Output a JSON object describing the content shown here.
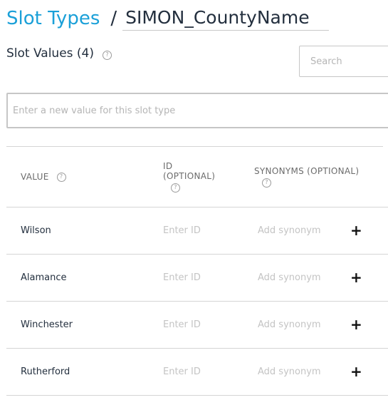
{
  "breadcrumb": {
    "link_label": "Slot Types",
    "separator": "/",
    "slot_type_name": "SIMON_CountyName"
  },
  "slot_values": {
    "title": "Slot Values (4)",
    "help_glyph": "?",
    "search_placeholder": "Search",
    "new_value_placeholder": "Enter a new value for this slot type"
  },
  "table": {
    "headers": {
      "value": "VALUE",
      "id_line1": "ID",
      "id_line2": "(OPTIONAL)",
      "synonyms": "SYNONYMS (OPTIONAL)"
    },
    "id_placeholder": "Enter ID",
    "synonym_placeholder": "Add synonym",
    "add_glyph": "+",
    "rows": [
      {
        "value": "Wilson"
      },
      {
        "value": "Alamance"
      },
      {
        "value": "Winchester"
      },
      {
        "value": "Rutherford"
      }
    ]
  },
  "icons": {
    "help": "question-circle-icon",
    "add": "plus-icon"
  },
  "colors": {
    "link": "#1ba0d8",
    "text": "#232f3e",
    "header_text": "#6b6b6b",
    "placeholder": "#c4c4c4",
    "border": "#d5d5d5"
  }
}
